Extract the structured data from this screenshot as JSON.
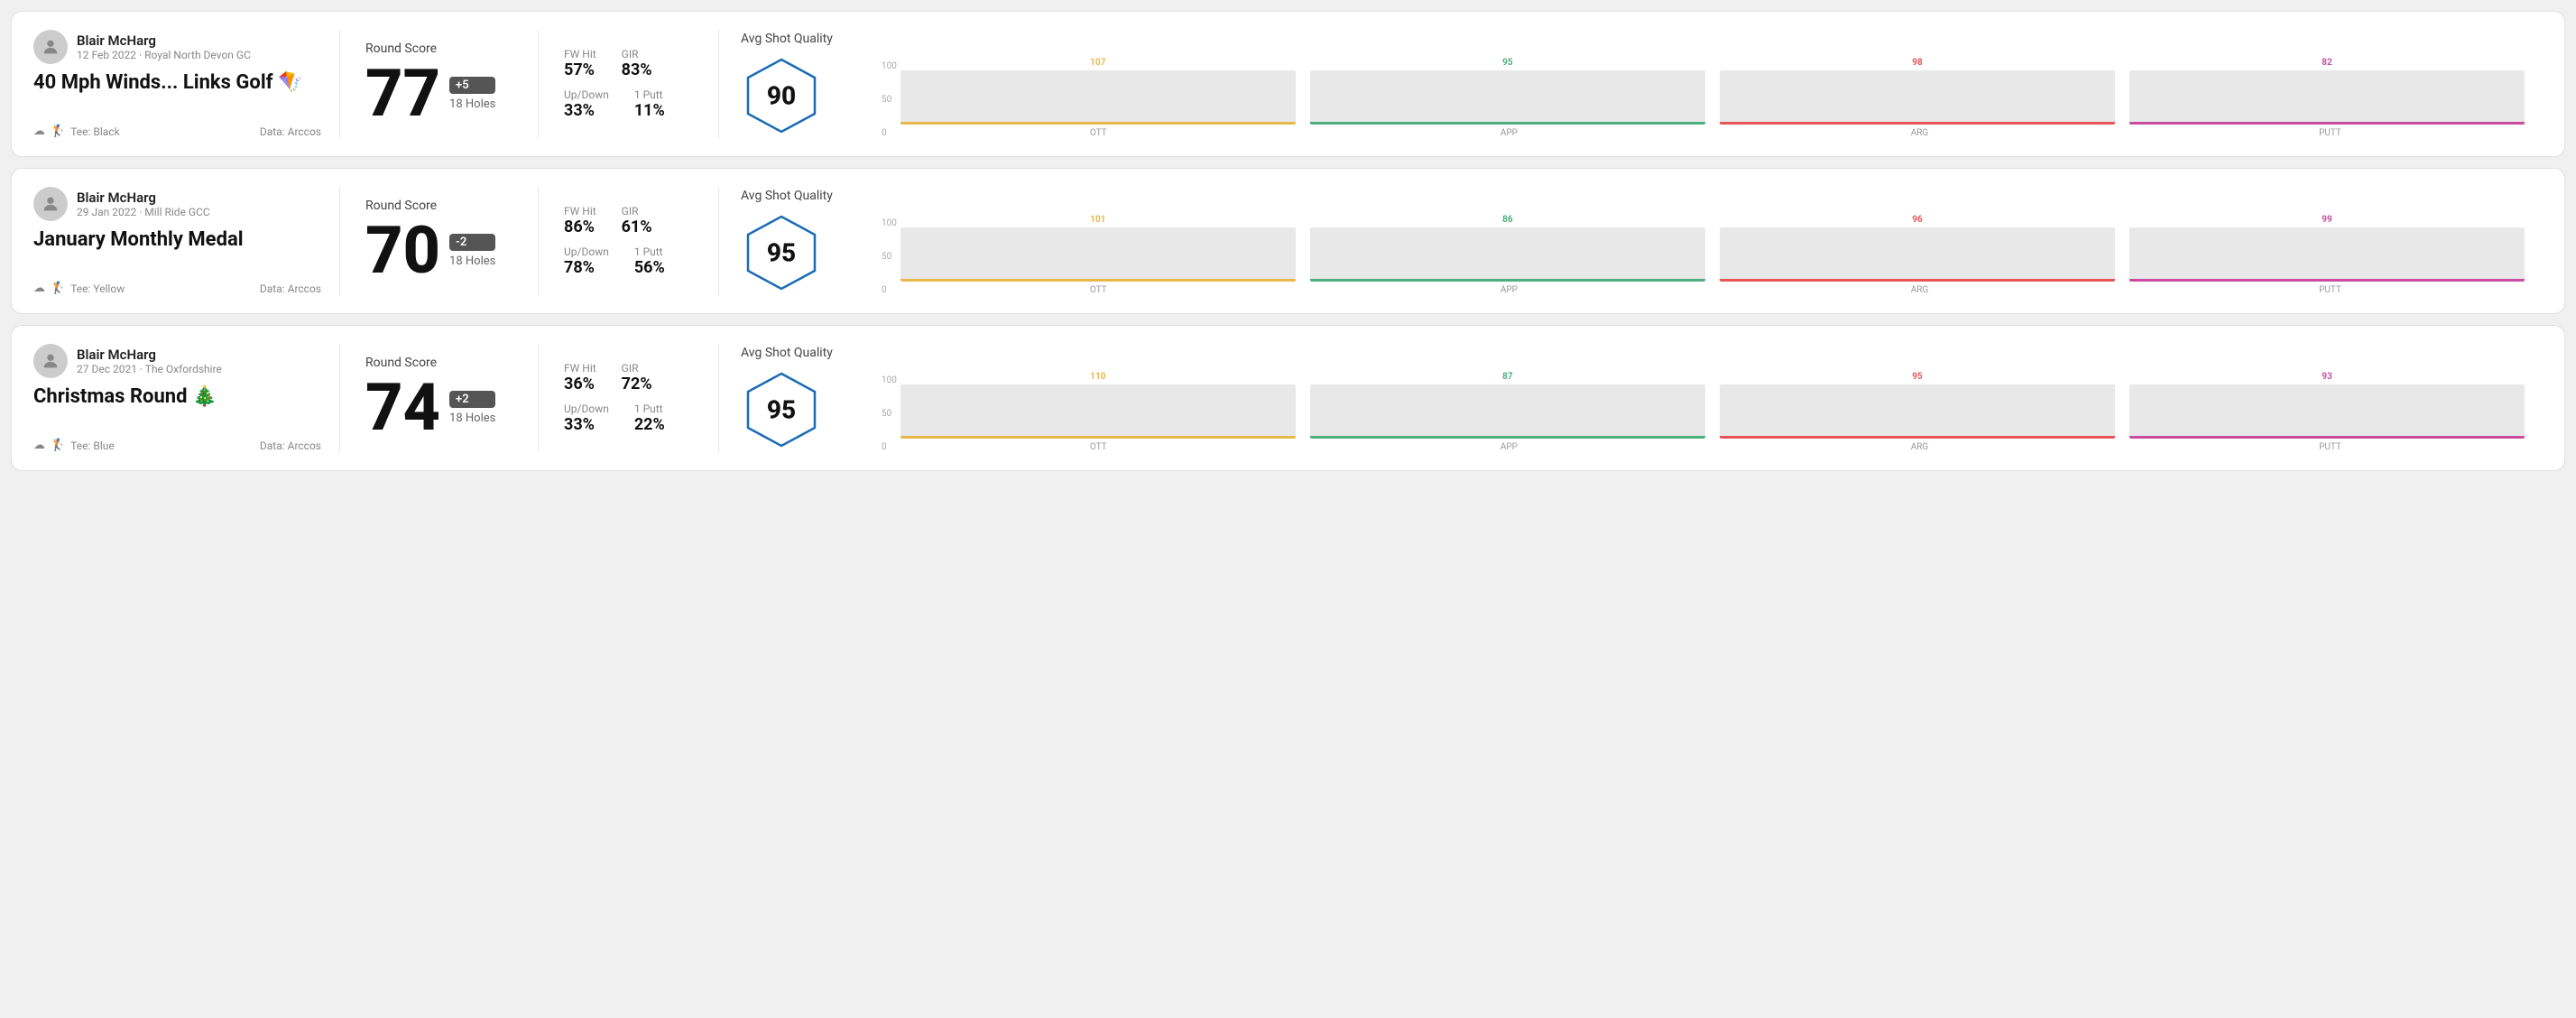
{
  "rounds": [
    {
      "id": "round1",
      "user": {
        "name": "Blair McHarg",
        "date": "12 Feb 2022 · Royal North Devon GC"
      },
      "title": "40 Mph Winds... Links Golf 🪁",
      "tee": "Black",
      "data_source": "Data: Arccos",
      "score": {
        "label": "Round Score",
        "value": "77",
        "modifier": "+5",
        "holes": "18 Holes"
      },
      "stats": {
        "fw_hit_label": "FW Hit",
        "fw_hit_value": "57%",
        "gir_label": "GIR",
        "gir_value": "83%",
        "updown_label": "Up/Down",
        "updown_value": "33%",
        "oneputt_label": "1 Putt",
        "oneputt_value": "11%"
      },
      "quality": {
        "label": "Avg Shot Quality",
        "value": "90"
      },
      "chart": {
        "bars": [
          {
            "label": "OTT",
            "value": 107,
            "color": "#e8b84b"
          },
          {
            "label": "APP",
            "value": 95,
            "color": "#4caf7d"
          },
          {
            "label": "ARG",
            "value": 98,
            "color": "#e85555"
          },
          {
            "label": "PUTT",
            "value": 82,
            "color": "#c84b9e"
          }
        ],
        "y_max": 100,
        "y_labels": [
          "100",
          "50",
          "0"
        ]
      }
    },
    {
      "id": "round2",
      "user": {
        "name": "Blair McHarg",
        "date": "29 Jan 2022 · Mill Ride GCC"
      },
      "title": "January Monthly Medal",
      "tee": "Yellow",
      "data_source": "Data: Arccos",
      "score": {
        "label": "Round Score",
        "value": "70",
        "modifier": "-2",
        "holes": "18 Holes"
      },
      "stats": {
        "fw_hit_label": "FW Hit",
        "fw_hit_value": "86%",
        "gir_label": "GIR",
        "gir_value": "61%",
        "updown_label": "Up/Down",
        "updown_value": "78%",
        "oneputt_label": "1 Putt",
        "oneputt_value": "56%"
      },
      "quality": {
        "label": "Avg Shot Quality",
        "value": "95"
      },
      "chart": {
        "bars": [
          {
            "label": "OTT",
            "value": 101,
            "color": "#e8b84b"
          },
          {
            "label": "APP",
            "value": 86,
            "color": "#4caf7d"
          },
          {
            "label": "ARG",
            "value": 96,
            "color": "#e85555"
          },
          {
            "label": "PUTT",
            "value": 99,
            "color": "#c84b9e"
          }
        ],
        "y_max": 100,
        "y_labels": [
          "100",
          "50",
          "0"
        ]
      }
    },
    {
      "id": "round3",
      "user": {
        "name": "Blair McHarg",
        "date": "27 Dec 2021 · The Oxfordshire"
      },
      "title": "Christmas Round 🎄",
      "tee": "Blue",
      "data_source": "Data: Arccos",
      "score": {
        "label": "Round Score",
        "value": "74",
        "modifier": "+2",
        "holes": "18 Holes"
      },
      "stats": {
        "fw_hit_label": "FW Hit",
        "fw_hit_value": "36%",
        "gir_label": "GIR",
        "gir_value": "72%",
        "updown_label": "Up/Down",
        "updown_value": "33%",
        "oneputt_label": "1 Putt",
        "oneputt_value": "22%"
      },
      "quality": {
        "label": "Avg Shot Quality",
        "value": "95"
      },
      "chart": {
        "bars": [
          {
            "label": "OTT",
            "value": 110,
            "color": "#e8b84b"
          },
          {
            "label": "APP",
            "value": 87,
            "color": "#4caf7d"
          },
          {
            "label": "ARG",
            "value": 95,
            "color": "#e85555"
          },
          {
            "label": "PUTT",
            "value": 93,
            "color": "#c84b9e"
          }
        ],
        "y_max": 100,
        "y_labels": [
          "100",
          "50",
          "0"
        ]
      }
    }
  ]
}
